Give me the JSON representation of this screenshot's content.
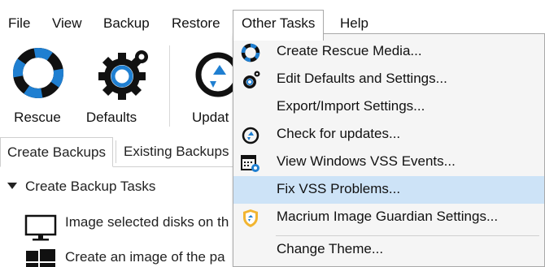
{
  "menubar": {
    "items": [
      "File",
      "View",
      "Backup",
      "Restore",
      "Other Tasks",
      "Help"
    ]
  },
  "ribbon": {
    "rescue_label": "Rescue",
    "defaults_label": "Defaults",
    "updates_label": "Updat"
  },
  "tabs": {
    "create_backups": "Create Backups",
    "existing_backups": "Existing Backups"
  },
  "content": {
    "section_title": "Create Backup Tasks",
    "task1": "Image selected disks on th",
    "task2": "Create an image of the pa"
  },
  "other_tasks_menu": {
    "items": [
      {
        "label": "Create Rescue Media...",
        "icon": "lifebuoy-icon"
      },
      {
        "label": "Edit Defaults and Settings...",
        "icon": "gears-icon"
      },
      {
        "label": "Export/Import Settings...",
        "icon": ""
      },
      {
        "label": "Check for updates...",
        "icon": "refresh-icon"
      },
      {
        "label": "View Windows VSS Events...",
        "icon": "calendar-gear-icon"
      },
      {
        "label": "Fix VSS Problems...",
        "icon": ""
      },
      {
        "label": "Macrium Image Guardian Settings...",
        "icon": "shield-icon"
      },
      {
        "label": "Change Theme...",
        "icon": ""
      }
    ],
    "highlighted_index": 5
  },
  "colors": {
    "accent_blue": "#1f7fd1",
    "highlight": "#cde3f7"
  }
}
